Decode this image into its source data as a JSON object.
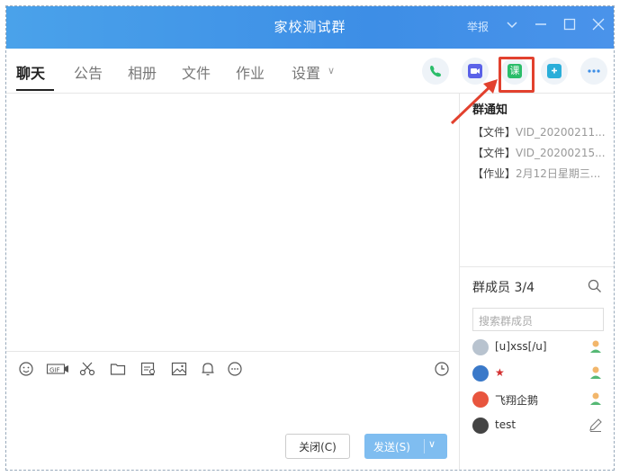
{
  "window": {
    "title": "家校测试群",
    "report_label": "举报"
  },
  "tabs": [
    {
      "label": "聊天",
      "active": true
    },
    {
      "label": "公告"
    },
    {
      "label": "相册"
    },
    {
      "label": "文件"
    },
    {
      "label": "作业"
    },
    {
      "label": "设置"
    }
  ],
  "header_actions": [
    {
      "icon": "phone-icon",
      "color": "#2bbd6a"
    },
    {
      "icon": "video-icon",
      "color": "#5b62e8"
    },
    {
      "icon": "course-icon",
      "label": "课",
      "color": "#2bbd6a"
    },
    {
      "icon": "message-plus-icon",
      "color": "#2aaed9"
    },
    {
      "icon": "more-icon",
      "color": "#3d8ee6"
    }
  ],
  "toolbar": {
    "icons": [
      "emoji-icon",
      "gif-icon",
      "scissors-icon",
      "folder-icon",
      "image-search-icon",
      "image-icon",
      "bell-icon",
      "more-circle-icon"
    ],
    "history_icon": "clock-icon"
  },
  "buttons": {
    "close": "关闭(C)",
    "send": "发送(S)"
  },
  "notice": {
    "heading": "群通知",
    "items": [
      {
        "tag": "【文件】",
        "text": "VID_20200211..."
      },
      {
        "tag": "【文件】",
        "text": "VID_20200215..."
      },
      {
        "tag": "【作业】",
        "text": "2月12日星期三..."
      }
    ]
  },
  "members": {
    "title": "群成员 3/4",
    "search_placeholder": "搜索群成员",
    "list": [
      {
        "name": "[u]xss[/u]",
        "role_icon": "teacher-icon"
      },
      {
        "name": "★",
        "role_icon": "teacher-icon"
      },
      {
        "name": "飞翔企鹅",
        "role_icon": "teacher-icon"
      },
      {
        "name": "test",
        "role_icon": "edit-icon"
      }
    ]
  },
  "colors": {
    "titlebar": "#3d8ee6",
    "highlight": "#e2412e",
    "send_button": "#7fbdf0"
  }
}
